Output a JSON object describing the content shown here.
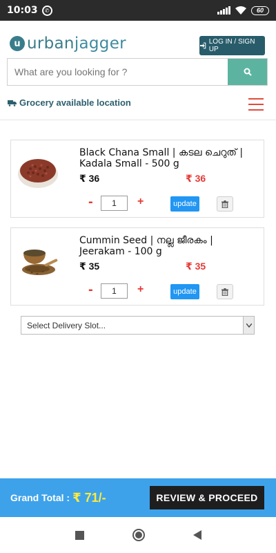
{
  "status_bar": {
    "time": "10:03",
    "battery": "60"
  },
  "header": {
    "logo_prefix": "urban",
    "logo_suffix": "jagger",
    "login_label": "LOG IN / SIGN UP",
    "search_placeholder": "What are you looking for ?",
    "location_label": "Grocery available location"
  },
  "cart": {
    "items": [
      {
        "name": "Black Chana Small | കടല ചെറുത് | Kadala Small - 500 g",
        "price": "₹ 36",
        "sale_price": "₹ 36",
        "quantity": "1",
        "update_label": "update"
      },
      {
        "name": "Cummin Seed | നല്ല ജീരകം | Jeerakam - 100 g",
        "price": "₹ 35",
        "sale_price": "₹ 35",
        "quantity": "1",
        "update_label": "update"
      }
    ],
    "minus_symbol": "-",
    "plus_symbol": "+"
  },
  "delivery": {
    "selected": "Select Delivery Slot..."
  },
  "footer": {
    "total_label": "Grand Total :",
    "total_value": "₹ 71/-",
    "proceed_label": "REVIEW & PROCEED"
  },
  "colors": {
    "brand": "#3f8aa0",
    "accent_red": "#e53935",
    "total_bar": "#3ea2ea",
    "search_button": "#5cb4a0"
  }
}
